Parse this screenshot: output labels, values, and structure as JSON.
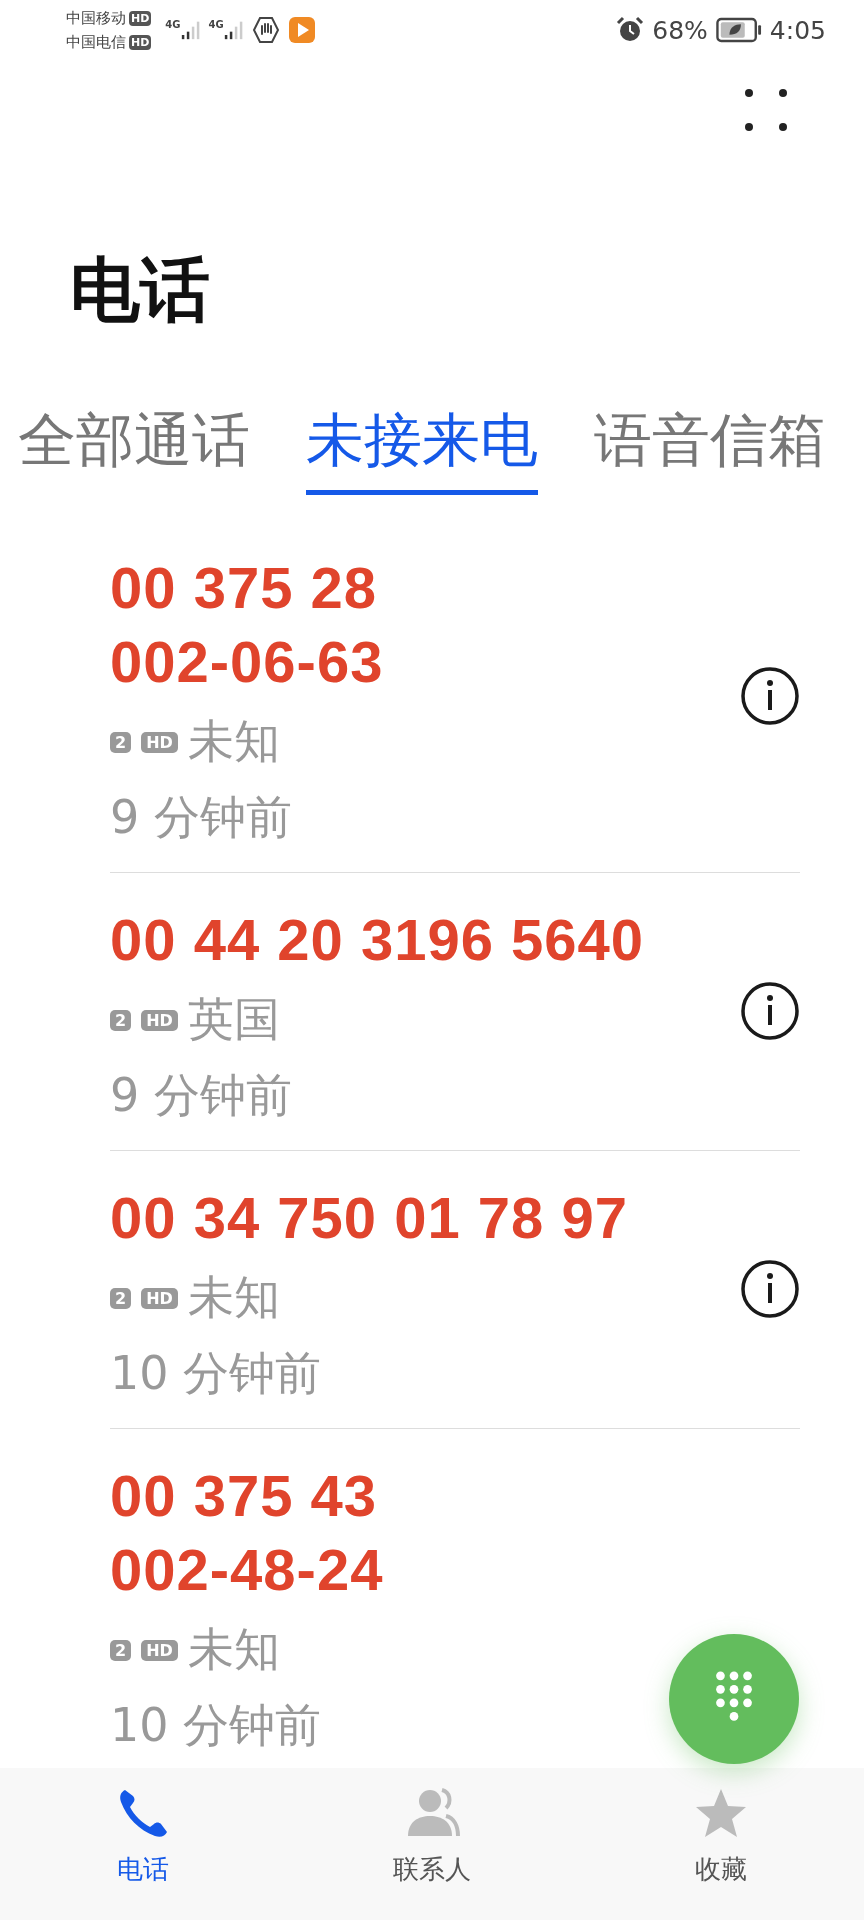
{
  "status_bar": {
    "carriers": [
      {
        "name": "中国移动",
        "badge": "HD"
      },
      {
        "name": "中国电信",
        "badge": "HD"
      }
    ],
    "network": [
      "4G",
      "4G"
    ],
    "battery_percent": "68%",
    "time": "4:05"
  },
  "title": "电话",
  "tabs": [
    {
      "label": "全部通话",
      "selected": false
    },
    {
      "label": "未接来电",
      "selected": true
    },
    {
      "label": "语音信箱",
      "selected": false
    }
  ],
  "calls": [
    {
      "number_lines": [
        "00 375 28",
        "002-06-63"
      ],
      "sim": "2",
      "hd": "HD",
      "location": "未知",
      "time": "9 分钟前",
      "info_button": true
    },
    {
      "number_lines": [
        "00 44 20 3196 5640"
      ],
      "sim": "2",
      "hd": "HD",
      "location": "英国",
      "time": "9 分钟前",
      "info_button": true
    },
    {
      "number_lines": [
        "00 34 750 01 78 97"
      ],
      "sim": "2",
      "hd": "HD",
      "location": "未知",
      "time": "10 分钟前",
      "info_button": true
    },
    {
      "number_lines": [
        "00 375 43",
        "002-48-24"
      ],
      "sim": "2",
      "hd": "HD",
      "location": "未知",
      "time": "10 分钟前",
      "info_button": false
    }
  ],
  "bottom_nav": [
    {
      "label": "电话",
      "kind": "phone",
      "selected": true
    },
    {
      "label": "联系人",
      "kind": "contacts",
      "selected": false
    },
    {
      "label": "收藏",
      "kind": "favorites",
      "selected": false
    }
  ]
}
